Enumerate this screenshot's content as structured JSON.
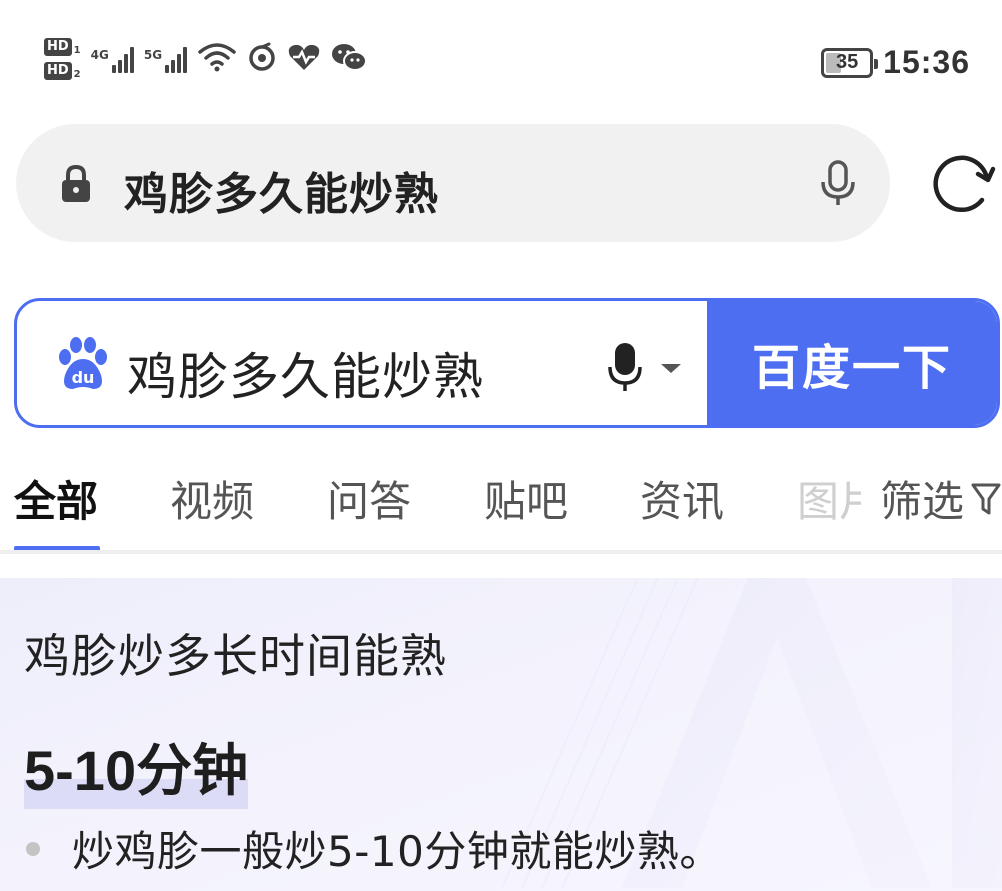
{
  "status_bar": {
    "sim1_label": "HD",
    "sim1_index": "1",
    "sim2_label": "HD",
    "sim2_index": "2",
    "net1_label": "4G",
    "net2_label": "5G",
    "battery_level": "35",
    "time": "15:36",
    "icons": [
      "wifi-icon",
      "data-saver-icon",
      "health-icon",
      "wechat-icon"
    ]
  },
  "address_bar": {
    "url_text": "鸡胗多久能炒熟",
    "icons": [
      "lock-icon",
      "microphone-icon",
      "refresh-icon"
    ]
  },
  "search_box": {
    "query": "鸡胗多久能炒熟",
    "submit_label": "百度一下",
    "accent_color": "#4e6ef2",
    "icons": [
      "baidu-paw-icon",
      "microphone-icon",
      "chevron-down-icon"
    ]
  },
  "tabs": {
    "items": [
      {
        "label": "全部",
        "active": true
      },
      {
        "label": "视频",
        "active": false
      },
      {
        "label": "问答",
        "active": false
      },
      {
        "label": "贴吧",
        "active": false
      },
      {
        "label": "资讯",
        "active": false
      },
      {
        "label": "图片",
        "active": false
      }
    ],
    "filter_label": "筛选",
    "filter_icon": "funnel-icon"
  },
  "result": {
    "title": "鸡胗炒多长时间能熟",
    "answer": "5-10分钟",
    "bullet": "炒鸡胗一般炒5-10分钟就能炒熟。"
  }
}
